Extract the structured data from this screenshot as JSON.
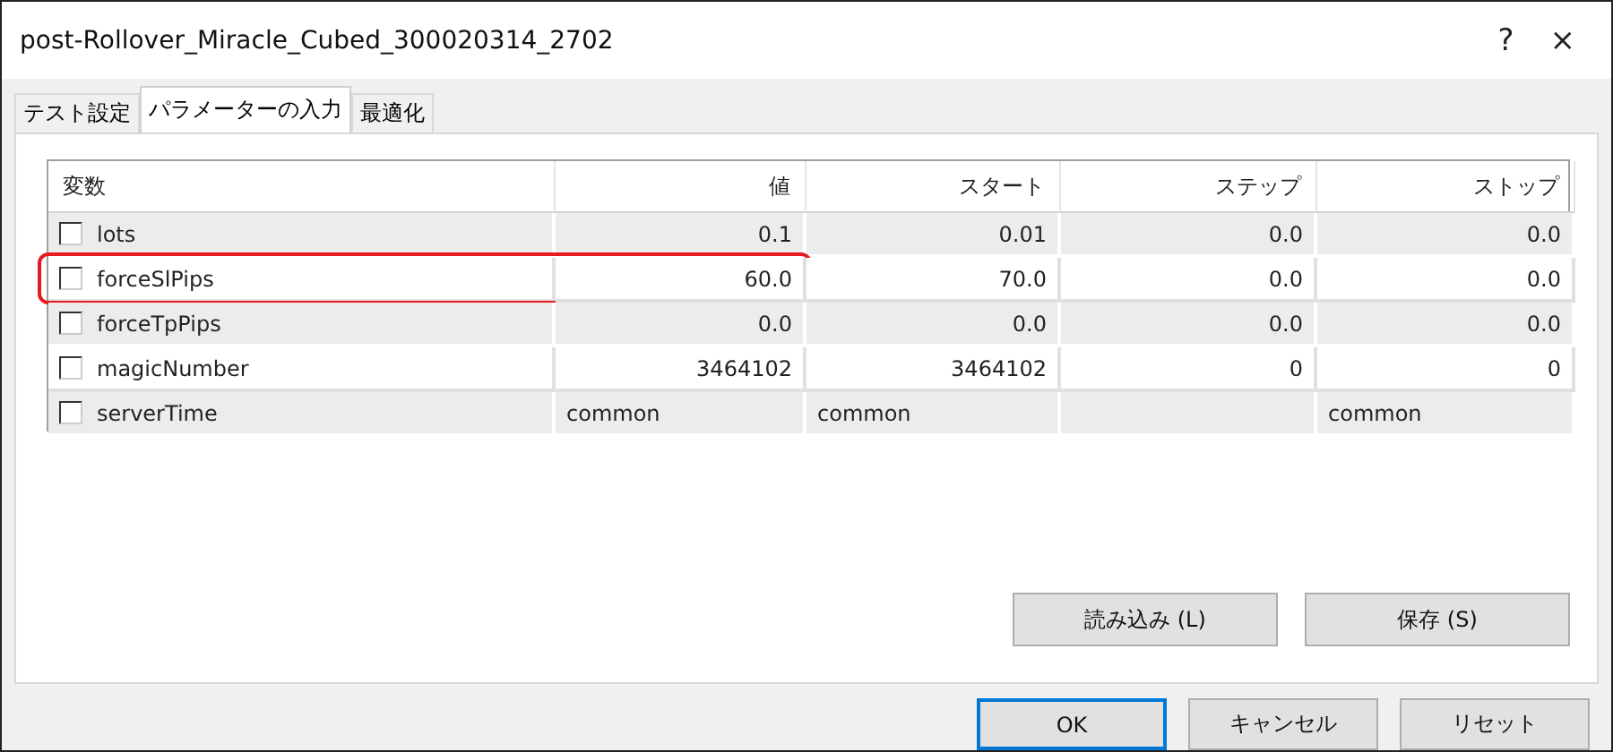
{
  "window": {
    "title": "post-Rollover_Miracle_Cubed_300020314_2702",
    "help": "?",
    "close": "×"
  },
  "tabs": [
    {
      "label": "テスト設定",
      "selected": false
    },
    {
      "label": "パラメーターの入力",
      "selected": true
    },
    {
      "label": "最適化",
      "selected": false
    }
  ],
  "table": {
    "columns": [
      "変数",
      "値",
      "スタート",
      "ステップ",
      "ストップ"
    ],
    "rows": [
      {
        "checked": false,
        "highlighted": false,
        "cells": [
          "lots",
          "0.1",
          "0.01",
          "0.0",
          "0.0"
        ],
        "kind": "number"
      },
      {
        "checked": false,
        "highlighted": true,
        "cells": [
          "forceSlPips",
          "60.0",
          "70.0",
          "0.0",
          "0.0"
        ],
        "kind": "number"
      },
      {
        "checked": false,
        "highlighted": false,
        "cells": [
          "forceTpPips",
          "0.0",
          "0.0",
          "0.0",
          "0.0"
        ],
        "kind": "number"
      },
      {
        "checked": false,
        "highlighted": false,
        "cells": [
          "magicNumber",
          "3464102",
          "3464102",
          "0",
          "0"
        ],
        "kind": "number"
      },
      {
        "checked": false,
        "highlighted": false,
        "cells": [
          "serverTime",
          "common",
          "common",
          "",
          "common"
        ],
        "kind": "text"
      }
    ]
  },
  "panel_buttons": [
    "読み込み (L)",
    "保存 (S)"
  ],
  "dialog_buttons": [
    {
      "label": "OK",
      "default": true
    },
    {
      "label": "キャンセル",
      "default": false
    },
    {
      "label": "リセット",
      "default": false
    }
  ]
}
